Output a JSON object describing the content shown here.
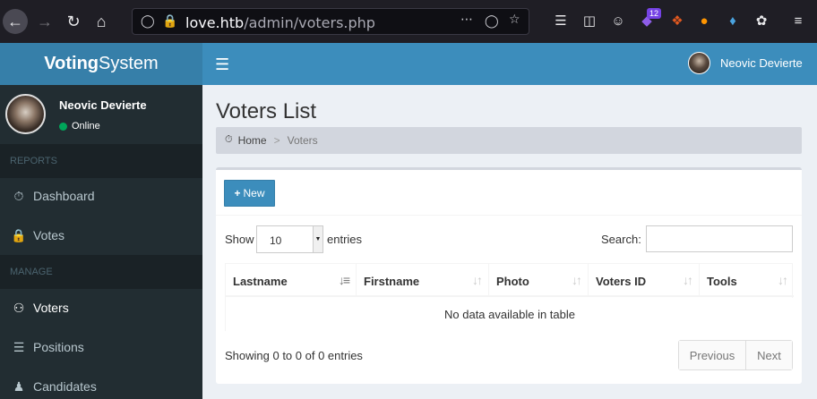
{
  "browser": {
    "url_host": "love.htb",
    "url_path": "/admin/voters.php",
    "extension_badge": "12"
  },
  "header": {
    "logo_bold": "Voting",
    "logo_rest": "System",
    "user_name": "Neovic Devierte"
  },
  "sidebar": {
    "user_name": "Neovic Devierte",
    "status": "Online",
    "sections": [
      {
        "header": "REPORTS",
        "items": [
          {
            "label": "Dashboard",
            "icon": "dashboard-icon"
          },
          {
            "label": "Votes",
            "icon": "lock-icon"
          }
        ]
      },
      {
        "header": "MANAGE",
        "items": [
          {
            "label": "Voters",
            "icon": "users-icon"
          },
          {
            "label": "Positions",
            "icon": "list-icon"
          },
          {
            "label": "Candidates",
            "icon": "user-icon"
          }
        ]
      }
    ]
  },
  "main": {
    "title": "Voters List",
    "breadcrumb": {
      "home": "Home",
      "current": "Voters"
    },
    "new_button": "New",
    "show_label": "Show",
    "entries_value": "10",
    "entries_label": "entries",
    "search_label": "Search:",
    "search_value": "",
    "columns": [
      "Lastname",
      "Firstname",
      "Photo",
      "Voters ID",
      "Tools"
    ],
    "empty_message": "No data available in table",
    "info": "Showing 0 to 0 of 0 entries",
    "pagination": {
      "previous": "Previous",
      "next": "Next"
    }
  },
  "colors": {
    "header_blue": "#3c8dbc",
    "logo_blue": "#367fa9",
    "sidebar_dark": "#222d32",
    "online_green": "#00a65a"
  }
}
